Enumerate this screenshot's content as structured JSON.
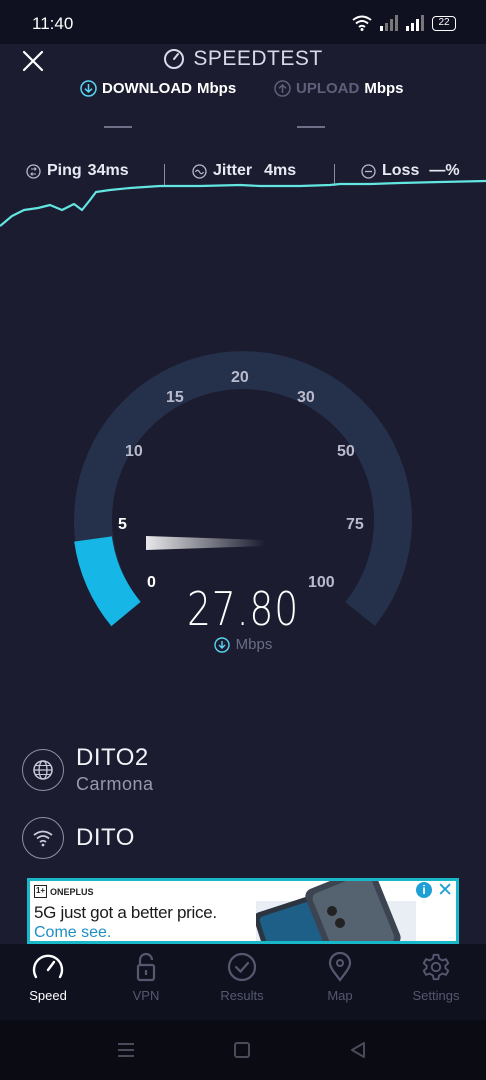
{
  "status_bar": {
    "time": "11:40",
    "battery": "22"
  },
  "header": {
    "title": "SPEEDTEST"
  },
  "tabs": {
    "download": {
      "label": "DOWNLOAD",
      "unit": "Mbps",
      "value": "—"
    },
    "upload": {
      "label": "UPLOAD",
      "unit": "Mbps",
      "value": "—"
    }
  },
  "stats": {
    "ping": {
      "label": "Ping",
      "value": "34ms"
    },
    "jitter": {
      "label": "Jitter",
      "value": "4ms"
    },
    "loss": {
      "label": "Loss",
      "value": "—%"
    }
  },
  "gauge": {
    "ticks": [
      "0",
      "5",
      "10",
      "15",
      "20",
      "30",
      "50",
      "75",
      "100"
    ],
    "speed": "27.80",
    "unit": "Mbps"
  },
  "server": {
    "name": "DITO2",
    "location": "Carmona"
  },
  "network": {
    "name": "DITO"
  },
  "ad": {
    "brand": "ONEPLUS",
    "brand_logo": "1+",
    "headline": "5G just got a better price.",
    "cta": "Come see.",
    "info": "i",
    "close": "✕"
  },
  "bottom_nav": [
    {
      "label": "Speed",
      "icon": "speedometer-icon",
      "active": true
    },
    {
      "label": "VPN",
      "icon": "unlock-icon",
      "active": false
    },
    {
      "label": "Results",
      "icon": "checkmark-circle-icon",
      "active": false
    },
    {
      "label": "Map",
      "icon": "map-pin-icon",
      "active": false
    },
    {
      "label": "Settings",
      "icon": "gear-icon",
      "active": false
    }
  ],
  "colors": {
    "accent": "#16b7e6",
    "background": "#1b1c30",
    "gauge_track": "#25304a",
    "graph_line": "#63e6e2"
  }
}
